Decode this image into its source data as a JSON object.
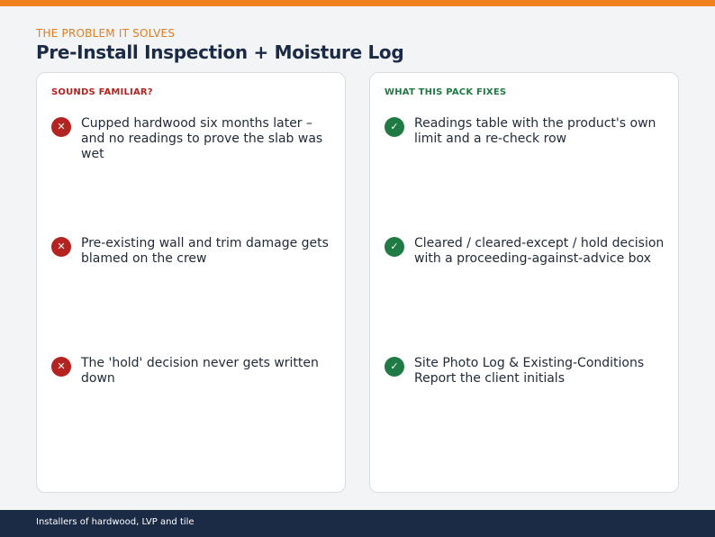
{
  "header": {
    "eyebrow": "THE PROBLEM IT SOLVES",
    "title": "Pre-Install Inspection + Moisture Log"
  },
  "problems": {
    "heading": "SOUNDS FAMILIAR?",
    "icon": "x-icon",
    "items": [
      "Cupped hardwood six months later – and no readings to prove the slab was wet",
      "Pre-existing wall and trim damage gets blamed on the crew",
      "The 'hold' decision never gets written down"
    ]
  },
  "fixes": {
    "heading": "WHAT THIS PACK FIXES",
    "icon": "check-icon",
    "items": [
      "Readings table with the product's own limit and a re-check row",
      "Cleared / cleared-except / hold decision with a proceeding-against-advice box",
      "Site Photo Log & Existing-Conditions Report the client initials"
    ]
  },
  "footer": {
    "text": "Installers of hardwood, LVP and tile"
  },
  "colors": {
    "accent": "#f07f1e",
    "navy": "#1c2b45",
    "problem": "#b4231f",
    "fix": "#1f7a43"
  }
}
